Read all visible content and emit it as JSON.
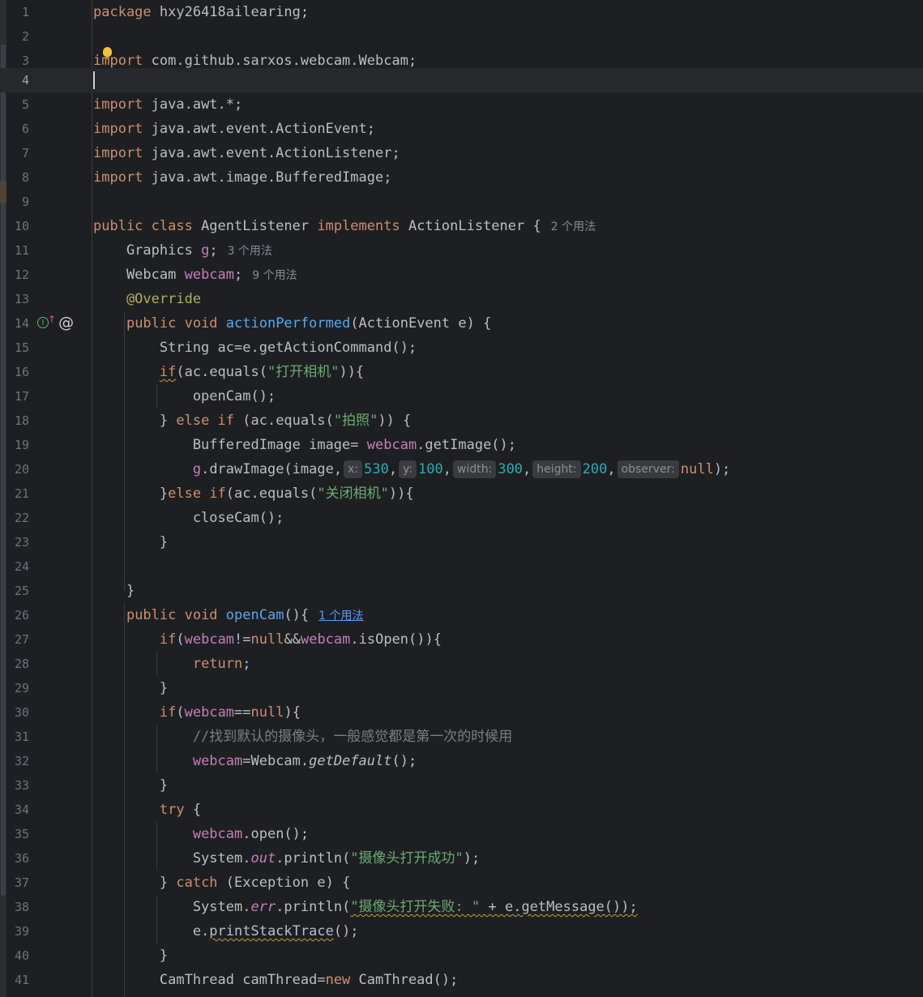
{
  "editor": {
    "current_line": 4,
    "lines": [
      {
        "n": "1"
      },
      {
        "n": "2"
      },
      {
        "n": "3"
      },
      {
        "n": "4"
      },
      {
        "n": "5"
      },
      {
        "n": "6"
      },
      {
        "n": "7"
      },
      {
        "n": "8"
      },
      {
        "n": "9"
      },
      {
        "n": "10"
      },
      {
        "n": "11"
      },
      {
        "n": "12"
      },
      {
        "n": "13"
      },
      {
        "n": "14"
      },
      {
        "n": "15"
      },
      {
        "n": "16"
      },
      {
        "n": "17"
      },
      {
        "n": "18"
      },
      {
        "n": "19"
      },
      {
        "n": "20"
      },
      {
        "n": "21"
      },
      {
        "n": "22"
      },
      {
        "n": "23"
      },
      {
        "n": "24"
      },
      {
        "n": "25"
      },
      {
        "n": "26"
      },
      {
        "n": "27"
      },
      {
        "n": "28"
      },
      {
        "n": "29"
      },
      {
        "n": "30"
      },
      {
        "n": "31"
      },
      {
        "n": "32"
      },
      {
        "n": "33"
      },
      {
        "n": "34"
      },
      {
        "n": "35"
      },
      {
        "n": "36"
      },
      {
        "n": "37"
      },
      {
        "n": "38"
      },
      {
        "n": "39"
      },
      {
        "n": "40"
      },
      {
        "n": "41"
      }
    ],
    "code": {
      "l1_kw": "package",
      "l1_rest": " hxy26418ailearing;",
      "l3_kw": "import",
      "l3_rest": " com.github.sarxos.webcam.Webcam;",
      "l5_kw": "import",
      "l5_rest": " java.awt.*;",
      "l6_kw": "import",
      "l6_rest": " java.awt.event.ActionEvent;",
      "l7_kw": "import",
      "l7_rest": " java.awt.event.ActionListener;",
      "l8_kw": "import",
      "l8_rest": " java.awt.image.BufferedImage;",
      "l10_kw1": "public class",
      "l10_name": " AgentListener ",
      "l10_kw2": "implements",
      "l10_rest": " ActionListener {",
      "l10_usage": "2 个用法",
      "l11_type": "    Graphics ",
      "l11_field": "g",
      "l11_end": ";",
      "l11_usage": "3 个用法",
      "l12_type": "    Webcam ",
      "l12_field": "webcam",
      "l12_end": ";",
      "l12_usage": "9 个用法",
      "l13_ann": "    @Override",
      "l14_ind": "    ",
      "l14_kw": "public void ",
      "l14_method": "actionPerformed",
      "l14_rest": "(ActionEvent e) {",
      "l15": "        String ac=e.getActionCommand();",
      "l16_ind": "        ",
      "l16_kw": "if",
      "l16_a": "(ac.equals(",
      "l16_s": "\"打开相机\"",
      "l16_b": ")){",
      "l17": "            openCam();",
      "l18_a": "        } ",
      "l18_kw": "else if",
      "l18_b": " (ac.equals(",
      "l18_s": "\"拍照\"",
      "l18_c": ")) {",
      "l19_a": "            BufferedImage image= ",
      "l19_f": "webcam",
      "l19_b": ".getImage();",
      "l20_ind": "            ",
      "l20_f": "g",
      "l20_a": ".drawImage(image,",
      "l20_h1": "x:",
      "l20_v1": "530",
      "l20_h2": "y:",
      "l20_v2": "100",
      "l20_h3": "width:",
      "l20_v3": "300",
      "l20_h4": "height:",
      "l20_v4": "200",
      "l20_h5": "observer:",
      "l20_kw": "null",
      "l20_end": ");",
      "l21_a": "        }",
      "l21_kw1": "else ",
      "l21_kw2": "if",
      "l21_b": "(ac.equals(",
      "l21_s": "\"关闭相机\"",
      "l21_c": ")){",
      "l22": "            closeCam();",
      "l23": "        }",
      "l25": "    }",
      "l26_ind": "    ",
      "l26_kw": "public void ",
      "l26_method": "openCam",
      "l26_rest": "(){",
      "l26_usage": "1 个用法",
      "l27_ind": "        ",
      "l27_kw": "if",
      "l27_a": "(",
      "l27_f1": "webcam",
      "l27_b": "!=",
      "l27_kw2": "null",
      "l27_c": "&&",
      "l27_f2": "webcam",
      "l27_d": ".isOpen()){",
      "l28_ind": "            ",
      "l28_kw": "return",
      "l28_end": ";",
      "l29": "        }",
      "l30_ind": "        ",
      "l30_kw": "if",
      "l30_a": "(",
      "l30_f": "webcam",
      "l30_b": "==",
      "l30_kw2": "null",
      "l30_c": "){",
      "l31": "            //找到默认的摄像头，一般感觉都是第一次的时候用",
      "l32_ind": "            ",
      "l32_f": "webcam",
      "l32_a": "=Webcam.",
      "l32_it": "getDefault",
      "l32_b": "();",
      "l33": "        }",
      "l34_ind": "        ",
      "l34_kw": "try",
      "l34_rest": " {",
      "l35_ind": "            ",
      "l35_f": "webcam",
      "l35_rest": ".open();",
      "l36_a": "            System.",
      "l36_st": "out",
      "l36_b": ".println(",
      "l36_s": "\"摄像头打开成功\"",
      "l36_c": ");",
      "l37_a": "        } ",
      "l37_kw": "catch",
      "l37_rest": " (Exception e) {",
      "l38_a": "            System.",
      "l38_st": "err",
      "l38_b": ".println(",
      "l38_s": "\"摄像头打开失败: \"",
      "l38_c": " + e.getMessage());",
      "l39_a": "            e.",
      "l39_w": "printStackTrace",
      "l39_b": "();",
      "l40": "        }",
      "l41_a": "        CamThread camThread=",
      "l41_kw": "new",
      "l41_b": " CamThread();"
    }
  }
}
